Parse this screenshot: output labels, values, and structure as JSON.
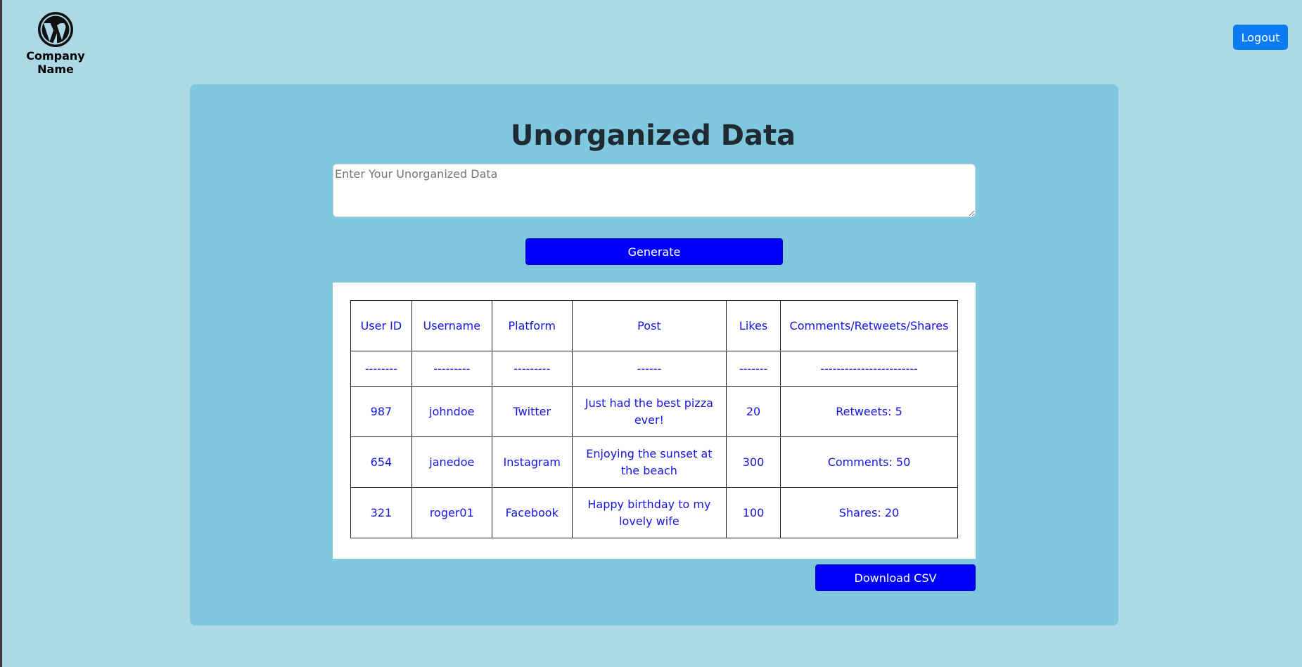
{
  "header": {
    "company_name": "Company Name",
    "logo_icon": "wordpress-logo-icon",
    "logout_label": "Logout"
  },
  "main": {
    "title": "Unorganized Data",
    "input_placeholder": "Enter Your Unorganized Data",
    "input_value": "",
    "generate_label": "Generate",
    "download_label": "Download CSV"
  },
  "table": {
    "headers": [
      "User ID",
      "Username",
      "Platform",
      "Post",
      "Likes",
      "Comments/Retweets/Shares"
    ],
    "separator": [
      "--------",
      "---------",
      "---------",
      "------",
      "-------",
      "------------------------"
    ],
    "rows": [
      [
        "987",
        "johndoe",
        "Twitter",
        "Just had the best pizza ever!",
        "20",
        "Retweets: 5"
      ],
      [
        "654",
        "janedoe",
        "Instagram",
        "Enjoying the sunset at the beach",
        "300",
        "Comments: 50"
      ],
      [
        "321",
        "roger01",
        "Facebook",
        "Happy birthday to my lovely wife",
        "100",
        "Shares: 20"
      ]
    ]
  },
  "colors": {
    "page_background": "#add8e6",
    "card_background": "#7fc8de",
    "primary_button": "#0000ff",
    "logout_button": "#0d7af5",
    "table_text": "#1414e6"
  }
}
